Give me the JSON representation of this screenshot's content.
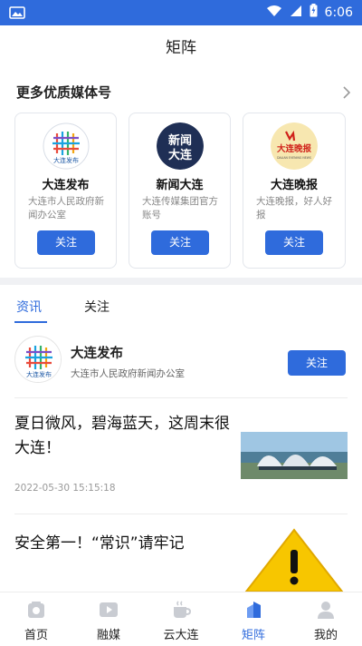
{
  "status_bar": {
    "time": "6:06",
    "image_icon": "image-icon",
    "wifi_icon": "wifi-icon",
    "signal_icon": "signal-icon",
    "battery_icon": "battery-charging-icon"
  },
  "header": {
    "title": "矩阵"
  },
  "recommend": {
    "title": "更多优质媒体号",
    "cards": [
      {
        "name": "大连发布",
        "desc": "大连市人民政府新闻办公室",
        "follow": "关注",
        "logo_text": "大连发布"
      },
      {
        "name": "新闻大连",
        "desc": "大连传媒集团官方账号",
        "follow": "关注",
        "logo_text_top": "新闻",
        "logo_text_bottom": "大连"
      },
      {
        "name": "大连晚报",
        "desc": "大连晚报，好人好报",
        "follow": "关注",
        "logo_text": "大连晚报",
        "logo_sub": "DALIAN EVENING NEWS"
      }
    ]
  },
  "tabs": [
    {
      "label": "资讯",
      "active": true
    },
    {
      "label": "关注",
      "active": false
    }
  ],
  "media": {
    "name": "大连发布",
    "desc": "大连市人民政府新闻办公室",
    "follow": "关注",
    "logo_text": "大连发布"
  },
  "articles": [
    {
      "title": "夏日微风，碧海蓝天，这周末很大连！",
      "time": "2022-05-30 15:15:18"
    },
    {
      "title": "安全第一！“常识”请牢记"
    }
  ],
  "bottom_nav": [
    {
      "label": "首页",
      "icon": "home-icon",
      "active": false
    },
    {
      "label": "融媒",
      "icon": "play-icon",
      "active": false
    },
    {
      "label": "云大连",
      "icon": "cup-icon",
      "active": false
    },
    {
      "label": "矩阵",
      "icon": "buildings-icon",
      "active": true
    },
    {
      "label": "我的",
      "icon": "user-icon",
      "active": false
    }
  ],
  "colors": {
    "accent": "#2f6bdc",
    "text": "#222222",
    "muted": "#888888"
  }
}
